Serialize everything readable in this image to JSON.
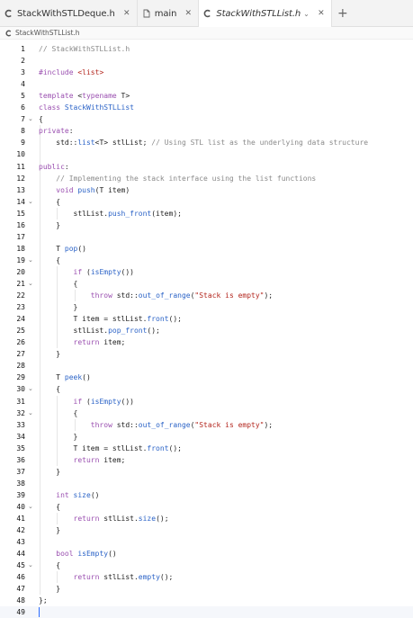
{
  "tabs": [
    {
      "name": "StackWithSTLDeque.h",
      "icon": "c-file-icon",
      "active": false
    },
    {
      "name": "main",
      "icon": "document-icon",
      "active": false
    },
    {
      "name": "StackWithSTLList.h",
      "icon": "c-file-icon",
      "active": true
    }
  ],
  "breadcrumb": "StackWithSTLList.h",
  "colors": {
    "comment": "#8a8a8a",
    "keyword": "#9a4fb0",
    "type": "#2b63c7",
    "string": "#b3261e",
    "caret": "#2b6cff"
  },
  "cursor_line": 49,
  "code_lines": [
    {
      "n": "1",
      "fold": false,
      "tokens": [
        [
          "comment",
          "// StackWithSTLList.h"
        ]
      ]
    },
    {
      "n": "2",
      "fold": false,
      "tokens": []
    },
    {
      "n": "3",
      "fold": false,
      "tokens": [
        [
          "keyword",
          "#include"
        ],
        [
          "plain",
          " "
        ],
        [
          "string",
          "<list>"
        ]
      ]
    },
    {
      "n": "4",
      "fold": false,
      "tokens": []
    },
    {
      "n": "5",
      "fold": false,
      "tokens": [
        [
          "keyword",
          "template"
        ],
        [
          "plain",
          " <"
        ],
        [
          "keyword",
          "typename"
        ],
        [
          "plain",
          " T>"
        ]
      ]
    },
    {
      "n": "6",
      "fold": false,
      "tokens": [
        [
          "keyword",
          "class"
        ],
        [
          "plain",
          " "
        ],
        [
          "type",
          "StackWithSTLList"
        ]
      ]
    },
    {
      "n": "7",
      "fold": true,
      "tokens": [
        [
          "plain",
          "{"
        ]
      ]
    },
    {
      "n": "8",
      "fold": false,
      "tokens": [
        [
          "keyword",
          "private"
        ],
        [
          "plain",
          ":"
        ]
      ]
    },
    {
      "n": "9",
      "fold": false,
      "tokens": [
        [
          "plain",
          "    std::"
        ],
        [
          "type",
          "list"
        ],
        [
          "plain",
          "<T> stlList; "
        ],
        [
          "comment",
          "// Using STL list as the underlying data structure"
        ]
      ]
    },
    {
      "n": "10",
      "fold": false,
      "tokens": []
    },
    {
      "n": "11",
      "fold": false,
      "tokens": [
        [
          "keyword",
          "public"
        ],
        [
          "plain",
          ":"
        ]
      ]
    },
    {
      "n": "12",
      "fold": false,
      "tokens": [
        [
          "plain",
          "    "
        ],
        [
          "comment",
          "// Implementing the stack interface using the list functions"
        ]
      ]
    },
    {
      "n": "13",
      "fold": false,
      "tokens": [
        [
          "plain",
          "    "
        ],
        [
          "keyword",
          "void"
        ],
        [
          "plain",
          " "
        ],
        [
          "func",
          "push"
        ],
        [
          "plain",
          "(T item)"
        ]
      ]
    },
    {
      "n": "14",
      "fold": true,
      "tokens": [
        [
          "plain",
          "    {"
        ]
      ]
    },
    {
      "n": "15",
      "fold": false,
      "tokens": [
        [
          "plain",
          "        stlList."
        ],
        [
          "func",
          "push_front"
        ],
        [
          "plain",
          "(item);"
        ]
      ]
    },
    {
      "n": "16",
      "fold": false,
      "tokens": [
        [
          "plain",
          "    }"
        ]
      ]
    },
    {
      "n": "17",
      "fold": false,
      "tokens": []
    },
    {
      "n": "18",
      "fold": false,
      "tokens": [
        [
          "plain",
          "    T "
        ],
        [
          "func",
          "pop"
        ],
        [
          "plain",
          "()"
        ]
      ]
    },
    {
      "n": "19",
      "fold": true,
      "tokens": [
        [
          "plain",
          "    {"
        ]
      ]
    },
    {
      "n": "20",
      "fold": false,
      "tokens": [
        [
          "plain",
          "        "
        ],
        [
          "keyword",
          "if"
        ],
        [
          "plain",
          " ("
        ],
        [
          "func",
          "isEmpty"
        ],
        [
          "plain",
          "())"
        ]
      ]
    },
    {
      "n": "21",
      "fold": true,
      "tokens": [
        [
          "plain",
          "        {"
        ]
      ]
    },
    {
      "n": "22",
      "fold": false,
      "tokens": [
        [
          "plain",
          "            "
        ],
        [
          "keyword",
          "throw"
        ],
        [
          "plain",
          " std::"
        ],
        [
          "func",
          "out_of_range"
        ],
        [
          "plain",
          "("
        ],
        [
          "string",
          "\"Stack is empty\""
        ],
        [
          "plain",
          ");"
        ]
      ]
    },
    {
      "n": "23",
      "fold": false,
      "tokens": [
        [
          "plain",
          "        }"
        ]
      ]
    },
    {
      "n": "24",
      "fold": false,
      "tokens": [
        [
          "plain",
          "        T item = stlList."
        ],
        [
          "func",
          "front"
        ],
        [
          "plain",
          "();"
        ]
      ]
    },
    {
      "n": "25",
      "fold": false,
      "tokens": [
        [
          "plain",
          "        stlList."
        ],
        [
          "func",
          "pop_front"
        ],
        [
          "plain",
          "();"
        ]
      ]
    },
    {
      "n": "26",
      "fold": false,
      "tokens": [
        [
          "plain",
          "        "
        ],
        [
          "keyword",
          "return"
        ],
        [
          "plain",
          " item;"
        ]
      ]
    },
    {
      "n": "27",
      "fold": false,
      "tokens": [
        [
          "plain",
          "    }"
        ]
      ]
    },
    {
      "n": "28",
      "fold": false,
      "tokens": []
    },
    {
      "n": "29",
      "fold": false,
      "tokens": [
        [
          "plain",
          "    T "
        ],
        [
          "func",
          "peek"
        ],
        [
          "plain",
          "()"
        ]
      ]
    },
    {
      "n": "30",
      "fold": true,
      "tokens": [
        [
          "plain",
          "    {"
        ]
      ]
    },
    {
      "n": "31",
      "fold": false,
      "tokens": [
        [
          "plain",
          "        "
        ],
        [
          "keyword",
          "if"
        ],
        [
          "plain",
          " ("
        ],
        [
          "func",
          "isEmpty"
        ],
        [
          "plain",
          "())"
        ]
      ]
    },
    {
      "n": "32",
      "fold": true,
      "tokens": [
        [
          "plain",
          "        {"
        ]
      ]
    },
    {
      "n": "33",
      "fold": false,
      "tokens": [
        [
          "plain",
          "            "
        ],
        [
          "keyword",
          "throw"
        ],
        [
          "plain",
          " std::"
        ],
        [
          "func",
          "out_of_range"
        ],
        [
          "plain",
          "("
        ],
        [
          "string",
          "\"Stack is empty\""
        ],
        [
          "plain",
          ");"
        ]
      ]
    },
    {
      "n": "34",
      "fold": false,
      "tokens": [
        [
          "plain",
          "        }"
        ]
      ]
    },
    {
      "n": "35",
      "fold": false,
      "tokens": [
        [
          "plain",
          "        T item = stlList."
        ],
        [
          "func",
          "front"
        ],
        [
          "plain",
          "();"
        ]
      ]
    },
    {
      "n": "36",
      "fold": false,
      "tokens": [
        [
          "plain",
          "        "
        ],
        [
          "keyword",
          "return"
        ],
        [
          "plain",
          " item;"
        ]
      ]
    },
    {
      "n": "37",
      "fold": false,
      "tokens": [
        [
          "plain",
          "    }"
        ]
      ]
    },
    {
      "n": "38",
      "fold": false,
      "tokens": []
    },
    {
      "n": "39",
      "fold": false,
      "tokens": [
        [
          "plain",
          "    "
        ],
        [
          "keyword",
          "int"
        ],
        [
          "plain",
          " "
        ],
        [
          "func",
          "size"
        ],
        [
          "plain",
          "()"
        ]
      ]
    },
    {
      "n": "40",
      "fold": true,
      "tokens": [
        [
          "plain",
          "    {"
        ]
      ]
    },
    {
      "n": "41",
      "fold": false,
      "tokens": [
        [
          "plain",
          "        "
        ],
        [
          "keyword",
          "return"
        ],
        [
          "plain",
          " stlList."
        ],
        [
          "func",
          "size"
        ],
        [
          "plain",
          "();"
        ]
      ]
    },
    {
      "n": "42",
      "fold": false,
      "tokens": [
        [
          "plain",
          "    }"
        ]
      ]
    },
    {
      "n": "43",
      "fold": false,
      "tokens": []
    },
    {
      "n": "44",
      "fold": false,
      "tokens": [
        [
          "plain",
          "    "
        ],
        [
          "keyword",
          "bool"
        ],
        [
          "plain",
          " "
        ],
        [
          "func",
          "isEmpty"
        ],
        [
          "plain",
          "()"
        ]
      ]
    },
    {
      "n": "45",
      "fold": true,
      "tokens": [
        [
          "plain",
          "    {"
        ]
      ]
    },
    {
      "n": "46",
      "fold": false,
      "tokens": [
        [
          "plain",
          "        "
        ],
        [
          "keyword",
          "return"
        ],
        [
          "plain",
          " stlList."
        ],
        [
          "func",
          "empty"
        ],
        [
          "plain",
          "();"
        ]
      ]
    },
    {
      "n": "47",
      "fold": false,
      "tokens": [
        [
          "plain",
          "    }"
        ]
      ]
    },
    {
      "n": "48",
      "fold": false,
      "tokens": [
        [
          "plain",
          "};"
        ]
      ]
    },
    {
      "n": "49",
      "fold": false,
      "tokens": []
    }
  ]
}
